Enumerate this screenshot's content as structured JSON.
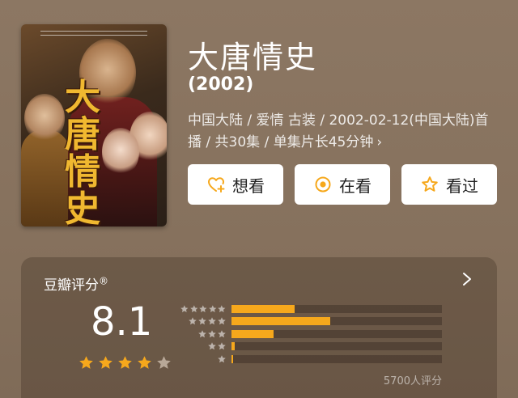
{
  "movie": {
    "title": "大唐情史",
    "year": "(2002)",
    "meta_line": "中国大陆 / 爱情 古装 / 2002-02-12(中国大陆)首播 / 共30集 / 单集片长45分钟",
    "meta_chevron": "›",
    "poster_title": "大唐情史",
    "poster_image_name": "drama-poster"
  },
  "actions": {
    "want_label": "想看",
    "watching_label": "在看",
    "watched_label": "看过"
  },
  "rating": {
    "header": "豆瓣评分",
    "header_mark": "®",
    "score": "8.1",
    "stars_filled": 4,
    "stars_total": 5,
    "count_text": "5700人评分",
    "distribution": [
      {
        "stars": 5,
        "fraction": 0.3
      },
      {
        "stars": 4,
        "fraction": 0.47
      },
      {
        "stars": 3,
        "fraction": 0.2
      },
      {
        "stars": 2,
        "fraction": 0.015
      },
      {
        "stars": 1,
        "fraction": 0.006
      }
    ]
  },
  "colors": {
    "accent": "#f6a81c",
    "background": "#8a7562",
    "card": "#5e4a39",
    "star_empty": "#b8a898"
  },
  "icons": {
    "want": "heart-plus-icon",
    "watching": "target-circle-icon",
    "watched": "star-outline-icon",
    "chevron": "chevron-right-icon"
  }
}
